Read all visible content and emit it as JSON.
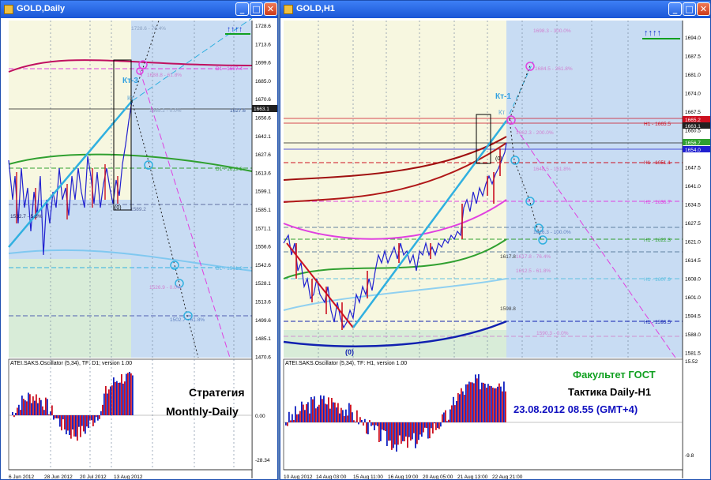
{
  "left_window": {
    "title": "GOLD,Daily",
    "price_labels": [
      "1728.6",
      "1713.6",
      "1699.6",
      "1685.0",
      "1670.6",
      "1656.6",
      "1642.1",
      "1627.6",
      "1613.6",
      "1599.1",
      "1585.1",
      "1571.1",
      "1556.6",
      "1542.6",
      "1528.1",
      "1513.6",
      "1499.6",
      "1485.1",
      "1470.6"
    ],
    "current_price": "1663.1",
    "level_labels": {
      "d1_1697": "D1 - 1697.4",
      "d1_1619": "D1 - 1619.3",
      "d1_1541": "D1 - 1541.2",
      "fib_1728": "1728.6 - 76.4%",
      "fib_1688": "1688.8 - 61.8%",
      "fib_1665": "1665.2 - 0.0%",
      "fib_1526": "1526.9 - 0.0%",
      "fib_1502": "1502.7 - 61.8%",
      "low_1589": "1589.2",
      "low_1532": "1532.7 - 5.8%",
      "label_a": "1627.6",
      "low_0": "(0)"
    },
    "wave_labels": {
      "kt3": "Кт-3",
      "kt": "Кт"
    },
    "arrows": "↑↑↑↑",
    "osc_title": "ATEI.SAKS.Oscillator (5,34), TF: D1; version 1.00",
    "osc_scale": [
      "0.00",
      "-28.34"
    ],
    "strategy_line1": "Стратегия",
    "strategy_line2": "Monthly-Daily",
    "dates": [
      "6 Jun 2012",
      "28 Jun 2012",
      "20 Jul 2012",
      "13 Aug 2012"
    ]
  },
  "right_window": {
    "title": "GOLD,H1",
    "price_labels": [
      "1694.0",
      "1687.5",
      "1681.0",
      "1674.0",
      "1667.5",
      "1660.5",
      "1654.0",
      "1647.5",
      "1641.0",
      "1634.5",
      "1627.5",
      "1621.0",
      "1614.5",
      "1608.0",
      "1601.0",
      "1594.5",
      "1588.0",
      "1581.5"
    ],
    "current_prices": {
      "p1": "1665.2",
      "p2": "1663.1",
      "p3": "1656.7",
      "p4": "1654.0"
    },
    "level_labels": {
      "h1_1665": "H1 - 1665.5",
      "h1_1651": "H1 - 1651.1",
      "h1_1636": "H1 - 1636.7",
      "h1_1622": "H1 - 1622.3",
      "h1_1607": "H1 - 1607.9",
      "h1_1593": "H1 - 1593.5",
      "fib_1698": "1698.3 - 300.0%",
      "fib_1684": "1684.5 - 261.8%",
      "fib_1662": "1662.3 - 200.0%",
      "fib_1648": "1648.5 - 161.8%",
      "fib_1626": "1626.3 - 100.0%",
      "fib_1617": "1617.8 - 76.4%",
      "fib_1612": "1612.5 - 61.8%",
      "fib_1590": "1590.3 - 0.0%",
      "mark_1617": "1617.8",
      "mark_1598": "1598.8",
      "wave_0a": "(0)",
      "wave_0b": "(0)"
    },
    "wave_labels": {
      "kt1": "Кт-1",
      "kt": "Кт"
    },
    "arrows": "↑↑↑↑",
    "osc_title": "ATEI.SAKS.Oscillator (5,34), TF: H1, version 1.00",
    "osc_scale": [
      "15.52",
      "-9.8"
    ],
    "faculty": "Факультет ГОСТ",
    "tactic": "Тактика Daily-H1",
    "datetime": "23.08.2012  08.55 (GMT+4)",
    "dates": [
      "10 Aug 2012",
      "14 Aug 03:00",
      "15 Aug 11:00",
      "16 Aug 19:00",
      "20 Aug 05:00",
      "21 Aug 13:00",
      "22 Aug 21:00"
    ]
  },
  "colors": {
    "title_bg": "#2463e0",
    "chart_bg": "#c6daf2",
    "price_line": "#2020d0",
    "bear_bar": "#cc1020",
    "teal_line": "#30b0e0",
    "magenta_line": "#e040e0",
    "green_ma": "#30a030",
    "red_ma": "#b01818",
    "blue_ma": "#1020b0",
    "faculty_green": "#10a020",
    "datetime_blue": "#1010c0"
  }
}
